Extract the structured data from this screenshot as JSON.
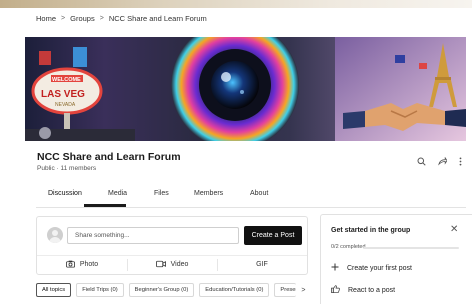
{
  "breadcrumb": [
    "Home",
    "Groups",
    "NCC Share and Learn Forum"
  ],
  "banner": {
    "sign_text": "LAS VEG",
    "sign_sub": "NEVADA",
    "marquee": "WELCOME"
  },
  "group": {
    "name": "NCC Share and Learn Forum",
    "meta": "Public · 11 members"
  },
  "tabs": [
    "Discussion",
    "Media",
    "Files",
    "Members",
    "About"
  ],
  "active_tab": "Discussion",
  "composer": {
    "placeholder": "Share something...",
    "create_label": "Create a Post",
    "actions": [
      {
        "label": "Photo",
        "icon": "camera-icon"
      },
      {
        "label": "Video",
        "icon": "video-icon"
      },
      {
        "label": "GIF",
        "icon": ""
      }
    ]
  },
  "topics": [
    "All topics",
    "Field Trips (0)",
    "Beginner's Group (0)",
    "Education/Tutorials (0)",
    "Presen"
  ],
  "getting_started": {
    "title": "Get started in the group",
    "progress_label": "0/2 completed",
    "progress": 0,
    "items": [
      {
        "label": "Create your first post",
        "icon": "plus-icon"
      },
      {
        "label": "React to a post",
        "icon": "thumbs-up-icon"
      }
    ]
  },
  "colors": {
    "accent": "#111111",
    "border": "#e1e1e1",
    "banner_gradient": [
      "#1c1f3a",
      "#b8a2c7"
    ]
  }
}
